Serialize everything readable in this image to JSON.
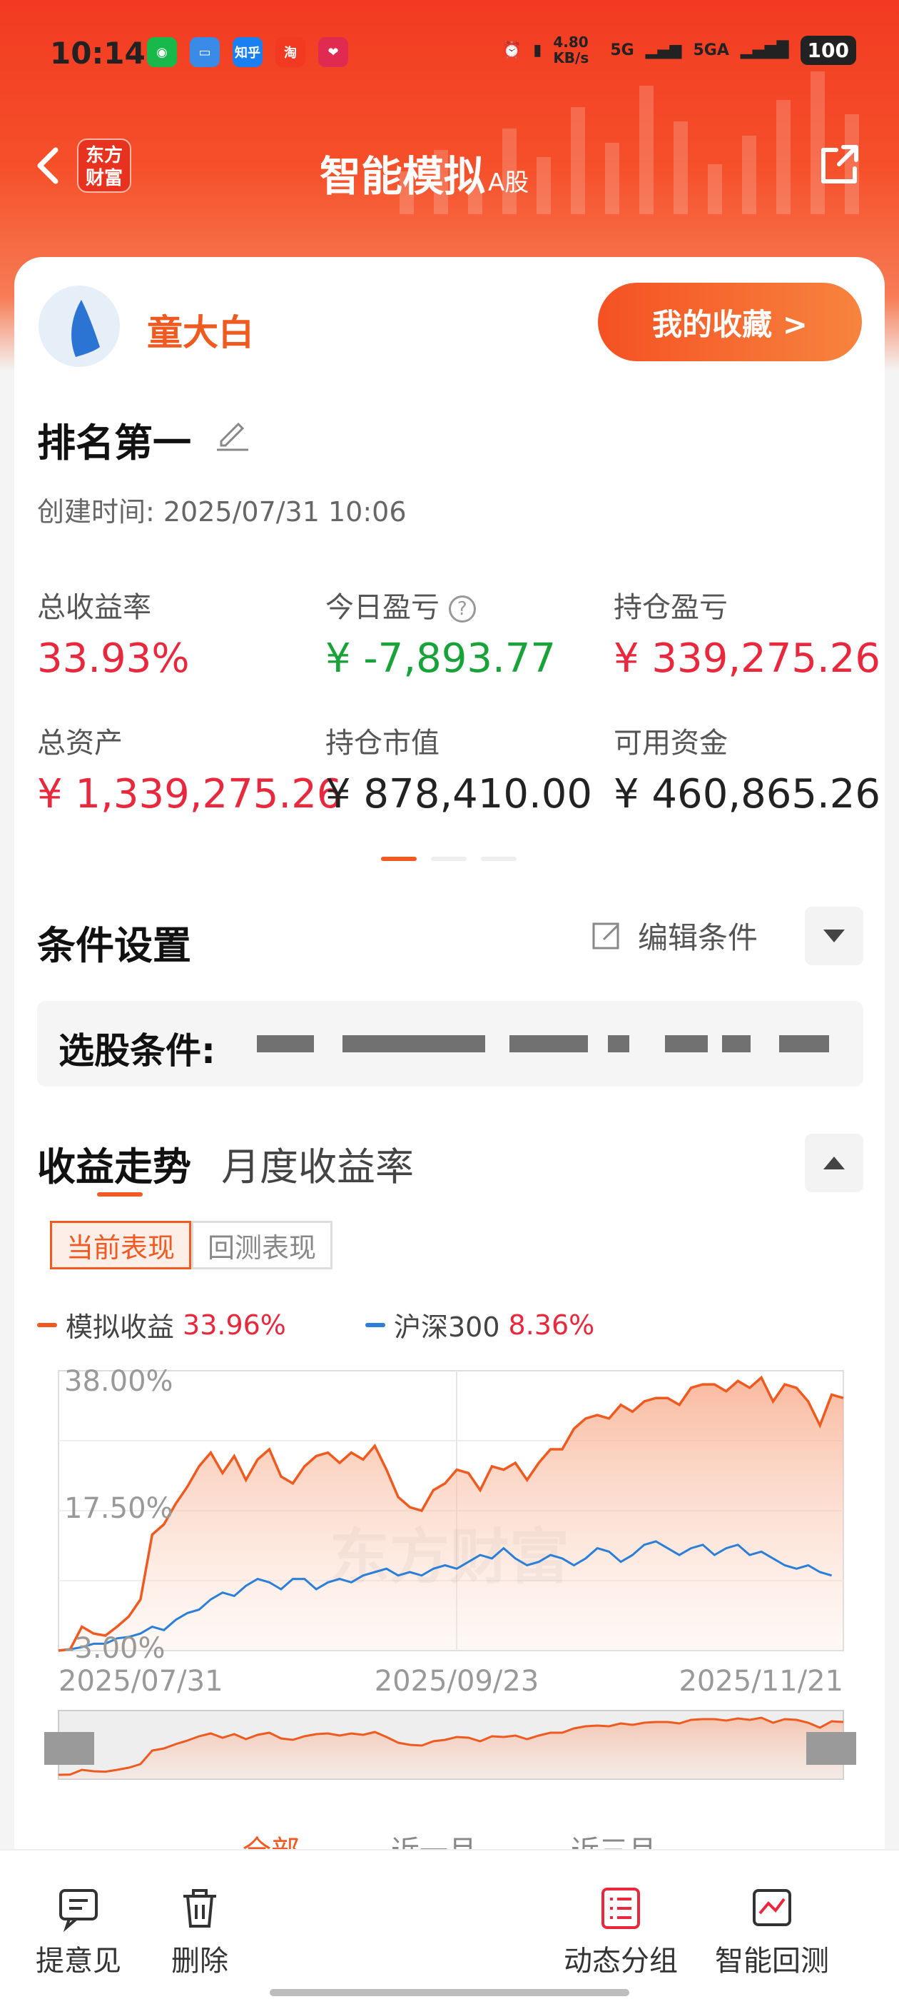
{
  "status": {
    "time": "10:14",
    "speed": "4.80 KB/s",
    "net1": "5G",
    "net2": "5GA",
    "battery": "100",
    "app_icons": [
      "wechat-icon",
      "wallet-icon",
      "zhihu-icon",
      "taobao-icon",
      "heart-app-icon"
    ],
    "zhihu": "知乎"
  },
  "header": {
    "logo": "东方财富",
    "title": "智能模拟",
    "title_suffix": "A股"
  },
  "user": {
    "name": "童大白",
    "favorites": "我的收藏 >"
  },
  "portfolio": {
    "name": "排名第一",
    "created": "创建时间:  2025/07/31 10:06",
    "stats": [
      {
        "label": "总收益率",
        "value": "33.93%"
      },
      {
        "label": "今日盈亏",
        "value": "¥ -7,893.77"
      },
      {
        "label": "持仓盈亏",
        "value": "¥ 339,275.26"
      },
      {
        "label": "总资产",
        "value": "¥ 1,339,275.26"
      },
      {
        "label": "持仓市值",
        "value": "¥ 878,410.00"
      },
      {
        "label": "可用资金",
        "value": "¥ 460,865.26"
      }
    ]
  },
  "conditions": {
    "title": "条件设置",
    "edit": "编辑条件",
    "label": "选股条件:"
  },
  "returns": {
    "tab_active": "收益走势",
    "tab_other": "月度收益率",
    "pill_active": "当前表现",
    "pill_other": "回测表现",
    "legend": [
      {
        "name": "模拟收益",
        "value": "33.96%",
        "color": "#ee5a1f"
      },
      {
        "name": "沪深300",
        "value": "8.36%",
        "color": "#2b7fd6"
      }
    ],
    "watermark": "东方财富",
    "ranges": [
      "全部",
      "近一月",
      "近三月"
    ]
  },
  "chart_data": {
    "type": "line",
    "x_ticks": [
      "2025/07/31",
      "2025/09/23",
      "2025/11/21"
    ],
    "y_ticks": [
      "38.00%",
      "17.50%",
      "-3.00%"
    ],
    "ylim": [
      -3.0,
      38.0
    ],
    "series": [
      {
        "name": "模拟收益",
        "color": "#ee5a1f",
        "values": [
          -3.0,
          -2.8,
          0.5,
          -0.5,
          -0.8,
          0.5,
          2.0,
          4.5,
          14.0,
          15.5,
          18.5,
          21.0,
          24.0,
          26.0,
          23.0,
          25.5,
          22.0,
          25.0,
          26.5,
          22.5,
          21.5,
          24.0,
          25.5,
          26.0,
          24.5,
          26.0,
          25.0,
          27.0,
          23.5,
          19.5,
          18.0,
          17.5,
          20.5,
          21.5,
          23.5,
          23.0,
          20.5,
          24.0,
          23.5,
          24.5,
          22.0,
          24.5,
          26.5,
          26.5,
          29.5,
          31.0,
          31.5,
          31.0,
          33.0,
          32.0,
          33.5,
          34.0,
          34.0,
          33.0,
          35.5,
          36.0,
          36.0,
          35.0,
          36.5,
          35.5,
          37.0,
          33.5,
          36.0,
          35.5,
          33.5,
          30.0,
          34.5,
          34.0
        ],
        "last": "33.96%"
      },
      {
        "name": "沪深300",
        "color": "#2b7fd6",
        "values": [
          -3.0,
          -2.8,
          -2.5,
          -2.0,
          -2.0,
          -1.2,
          -1.0,
          -0.5,
          0.5,
          0.0,
          1.5,
          2.5,
          3.0,
          4.5,
          5.5,
          5.0,
          6.5,
          7.5,
          7.0,
          6.0,
          7.5,
          7.5,
          6.0,
          7.0,
          7.5,
          7.0,
          8.0,
          8.5,
          9.0,
          8.0,
          8.5,
          8.0,
          9.0,
          9.5,
          9.0,
          10.0,
          11.0,
          10.5,
          12.0,
          10.5,
          9.5,
          10.0,
          11.0,
          10.5,
          9.5,
          10.5,
          12.0,
          11.5,
          10.0,
          11.0,
          12.5,
          13.0,
          12.0,
          11.0,
          12.0,
          12.5,
          11.0,
          12.0,
          12.5,
          11.0,
          11.5,
          10.5,
          9.5,
          9.0,
          9.5,
          8.5,
          8.0
        ],
        "last": "8.36%"
      }
    ]
  },
  "bottom": {
    "items": [
      {
        "label": "提意见",
        "icon": "feedback-icon"
      },
      {
        "label": "删除",
        "icon": "trash-icon"
      },
      {
        "label": "动态分组",
        "icon": "list-icon"
      },
      {
        "label": "智能回测",
        "icon": "backtest-icon"
      }
    ]
  }
}
